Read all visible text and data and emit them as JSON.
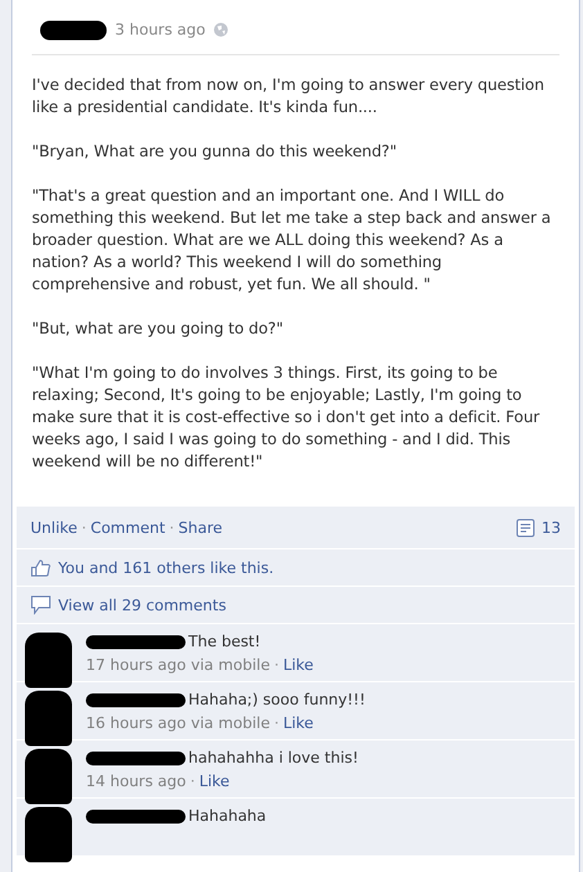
{
  "post": {
    "time": "3 hours ago",
    "paragraphs": [
      "I've decided that from now on, I'm going to answer every question like a presidential candidate. It's kinda fun....",
      "\"Bryan, What are you gunna do this weekend?\"",
      "\"That's a great question and an important one. And I WILL do something this weekend. But let me take a step back and answer a broader question. What are we ALL doing this weekend? As a nation? As a world? This weekend I will do something comprehensive and robust, yet fun. We all should. \"",
      "\"But, what are you going to do?\"",
      "\"What I'm going to do involves 3 things. First, its going to be relaxing; Second, It's going to be enjoyable; Lastly, I'm going to make sure that it is cost-effective so i don't get into a deficit. Four weeks ago, I said I was going to do something - and I did. This weekend will be no different!\""
    ]
  },
  "separator": "·",
  "actions": [
    "Unlike",
    "Comment",
    "Share"
  ],
  "share_count": "13",
  "likes": "You and 161 others like this.",
  "view_all": "View all 29 comments",
  "comments": [
    {
      "text": "The best!",
      "time": "17 hours ago via mobile",
      "like": "Like"
    },
    {
      "text": "Hahaha;) sooo funny!!!",
      "time": "16 hours ago via mobile",
      "like": "Like"
    },
    {
      "text": "hahahahha i love this!",
      "time": "14 hours ago",
      "like": "Like"
    },
    {
      "text": "Hahahaha"
    }
  ]
}
